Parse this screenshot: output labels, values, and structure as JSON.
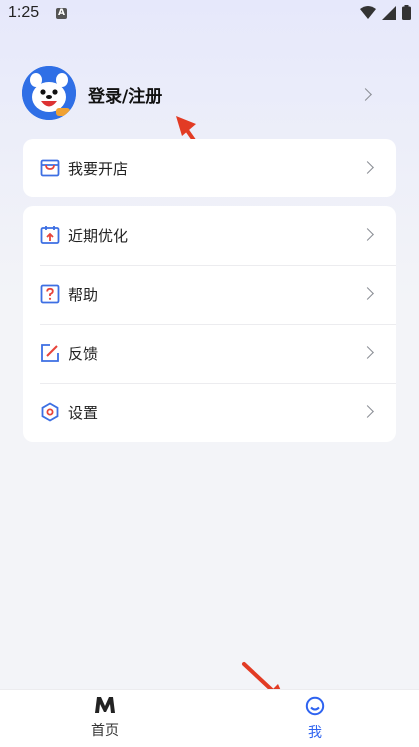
{
  "status_bar": {
    "time": "1:25",
    "notif_letter": "A"
  },
  "profile": {
    "login_label": "登录/注册"
  },
  "menu_top": [
    {
      "label": "我要开店",
      "icon": "store-icon"
    }
  ],
  "menu_main": [
    {
      "label": "近期优化",
      "icon": "calendar-icon"
    },
    {
      "label": "帮助",
      "icon": "help-icon"
    },
    {
      "label": "反馈",
      "icon": "feedback-edit-icon"
    },
    {
      "label": "设置",
      "icon": "settings-hex-icon"
    }
  ],
  "tabbar": {
    "home_label": "首页",
    "me_label": "我",
    "active": "me"
  },
  "colors": {
    "accent": "#2e63f0",
    "icon_blue": "#3d6fe3",
    "icon_red": "#e8443a",
    "arrow_red": "#e23b24"
  }
}
